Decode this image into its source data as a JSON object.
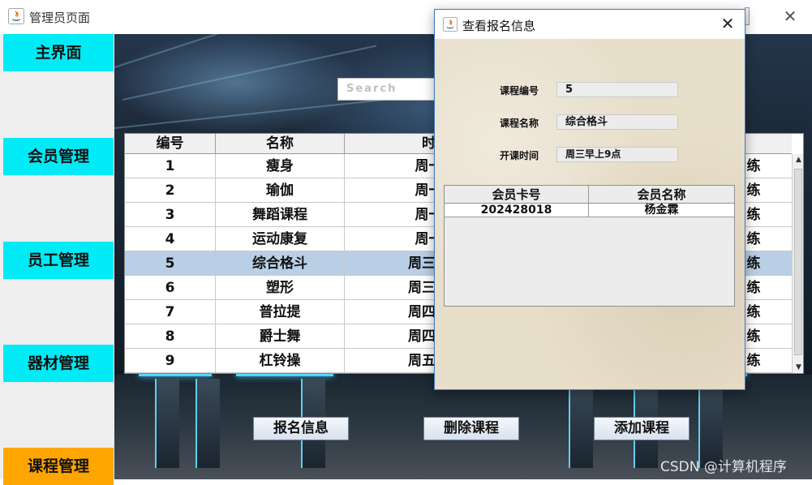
{
  "window": {
    "title": "管理员页面",
    "close_glyph": "✕"
  },
  "sidebar": {
    "items": [
      {
        "label": "主界面"
      },
      {
        "label": "会员管理"
      },
      {
        "label": "员工管理"
      },
      {
        "label": "器材管理"
      },
      {
        "label": "课程管理",
        "active": true
      }
    ]
  },
  "search": {
    "placeholder": "Search"
  },
  "course_table": {
    "columns": [
      "编号",
      "名称",
      "时",
      ""
    ],
    "rows": [
      {
        "id": "1",
        "name": "瘦身",
        "time": "周一",
        "col4": "练"
      },
      {
        "id": "2",
        "name": "瑜伽",
        "time": "周一",
        "col4": "练"
      },
      {
        "id": "3",
        "name": "舞蹈课程",
        "time": "周一",
        "col4": "练"
      },
      {
        "id": "4",
        "name": "运动康复",
        "time": "周一",
        "col4": "练"
      },
      {
        "id": "5",
        "name": "综合格斗",
        "time": "周三早",
        "col4": "练",
        "selected": true
      },
      {
        "id": "6",
        "name": "塑形",
        "time": "周三早",
        "col4": "练"
      },
      {
        "id": "7",
        "name": "普拉提",
        "time": "周四早",
        "col4": "练"
      },
      {
        "id": "8",
        "name": "爵士舞",
        "time": "周四早",
        "col4": "练"
      },
      {
        "id": "9",
        "name": "杠铃操",
        "time": "周五早",
        "col4": "练"
      }
    ]
  },
  "actions": {
    "signup_info": "报名信息",
    "delete_course": "删除课程",
    "add_course": "添加课程"
  },
  "dialog": {
    "title": "查看报名信息",
    "close_glyph": "✕",
    "fields": {
      "course_id_label": "课程编号",
      "course_id_value": "5",
      "course_name_label": "课程名称",
      "course_name_value": "综合格斗",
      "start_time_label": "开课时间",
      "start_time_value": "周三早上9点"
    },
    "members_table": {
      "columns": [
        "会员卡号",
        "会员名称"
      ],
      "rows": [
        {
          "card": "202428018",
          "name": "杨金霖"
        }
      ]
    }
  },
  "watermark": "CSDN @计算机程序",
  "colors": {
    "nav": "#00ebf5",
    "nav_active": "#ffa500",
    "selection": "#b8cfe5"
  }
}
